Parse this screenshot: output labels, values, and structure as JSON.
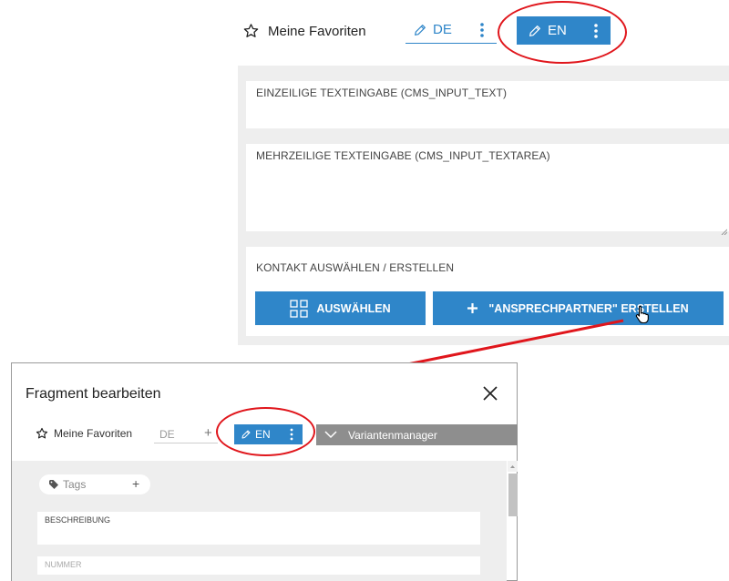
{
  "top": {
    "favorites_label": "Meine Favoriten",
    "tab_de": "DE",
    "tab_en": "EN",
    "fields": [
      {
        "label": "EINZEILIGE TEXTEINGABE (CMS_INPUT_TEXT)"
      },
      {
        "label": "MEHRZEILIGE TEXTEINGABE (CMS_INPUT_TEXTAREA)"
      },
      {
        "label": "KONTAKT AUSWÄHLEN / ERSTELLEN"
      }
    ],
    "select_button": "AUSWÄHLEN",
    "create_button": "\"ANSPRECHPARTNER\" ERSTELLEN"
  },
  "dialog": {
    "title": "Fragment bearbeiten",
    "favorites_label": "Meine Favoriten",
    "tab_de": "DE",
    "tab_en": "EN",
    "variant_manager": "Variantenmanager",
    "tags_label": "Tags",
    "description_label": "BESCHREIBUNG",
    "number_label": "NUMMER"
  },
  "colors": {
    "accent": "#2f86c9",
    "annotation_red": "#e0161c",
    "panel_bg": "#eeeeee",
    "variant_bar": "#8e8e8e"
  }
}
